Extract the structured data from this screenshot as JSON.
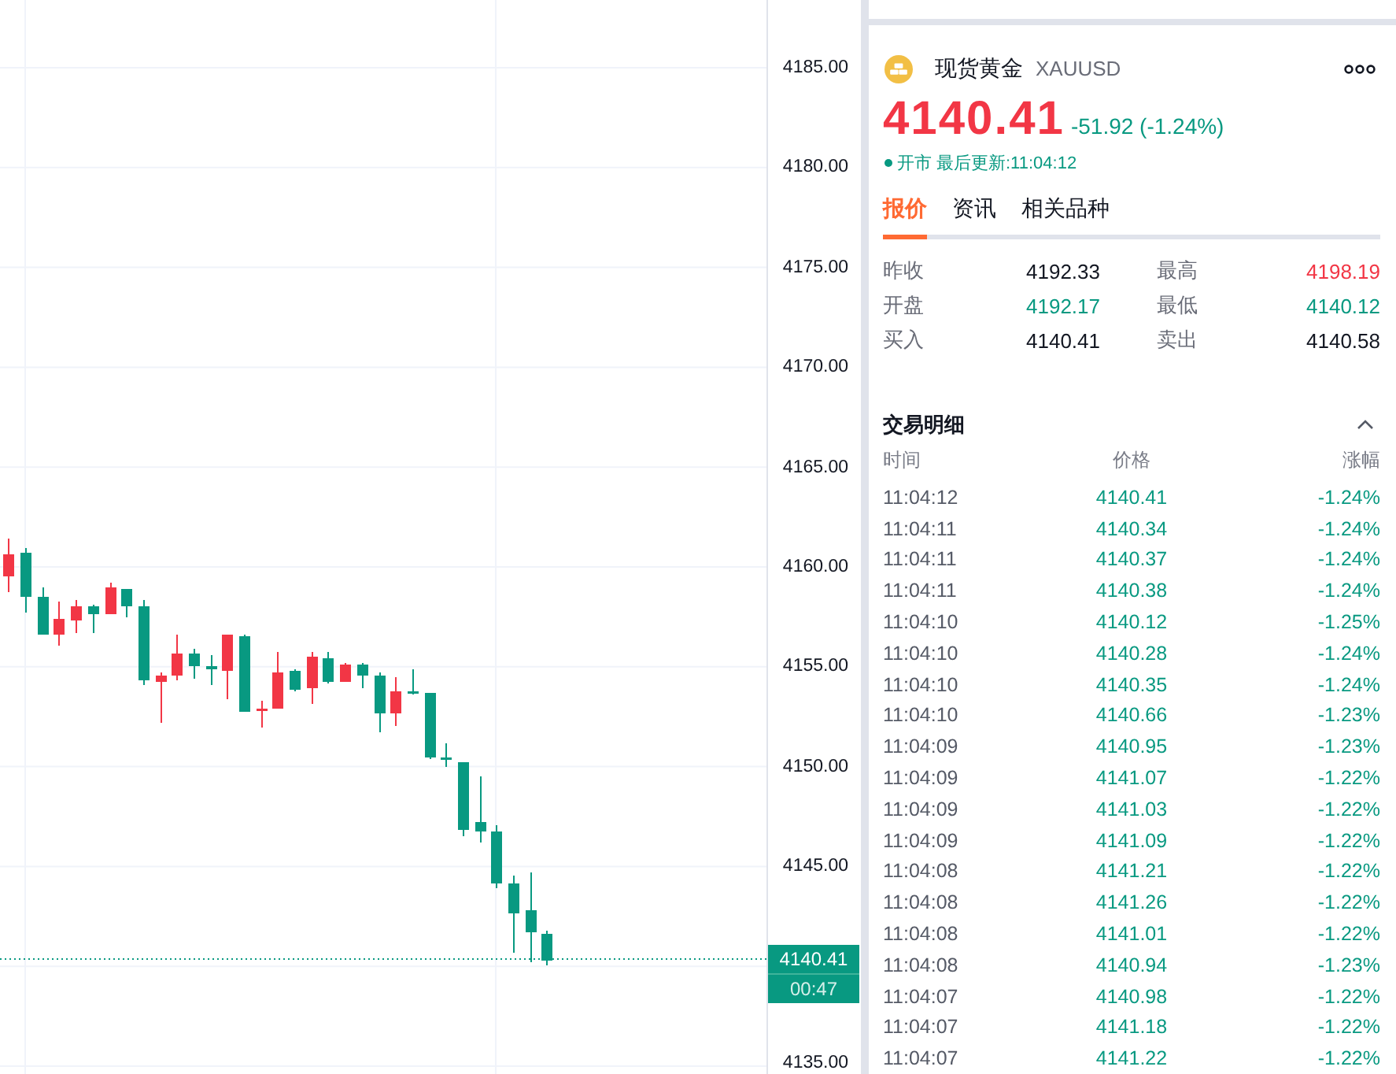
{
  "price_axis": {
    "labels": [
      "4185.00",
      "4180.00",
      "4175.00",
      "4170.00",
      "4165.00",
      "4160.00",
      "4155.00",
      "4150.00",
      "4145.00",
      "4135.00"
    ]
  },
  "last_price_tag": {
    "price": "4140.41",
    "countdown": "00:47"
  },
  "instrument": {
    "name": "现货黄金",
    "symbol": "XAUUSD"
  },
  "quote": {
    "price": "4140.41",
    "change": "-51.92 (-1.24%)",
    "status": "开市",
    "updated": "最后更新:11:04:12"
  },
  "tabs": [
    {
      "label": "报价",
      "selected": true
    },
    {
      "label": "资讯",
      "selected": false
    },
    {
      "label": "相关品种",
      "selected": false
    }
  ],
  "stats": [
    {
      "label": "昨收",
      "value": "4192.33",
      "color": "#131722"
    },
    {
      "label": "最高",
      "value": "4198.19",
      "color": "#f23645"
    },
    {
      "label": "开盘",
      "value": "4192.17",
      "color": "#089981"
    },
    {
      "label": "最低",
      "value": "4140.12",
      "color": "#089981"
    },
    {
      "label": "买入",
      "value": "4140.41",
      "color": "#131722"
    },
    {
      "label": "卖出",
      "value": "4140.58",
      "color": "#131722"
    }
  ],
  "trades": {
    "title": "交易明细",
    "expanded": true,
    "columns": [
      "时间",
      "价格",
      "涨幅"
    ],
    "rows": [
      {
        "time": "11:04:12",
        "price": "4140.41",
        "change": "-1.24%"
      },
      {
        "time": "11:04:11",
        "price": "4140.34",
        "change": "-1.24%"
      },
      {
        "time": "11:04:11",
        "price": "4140.37",
        "change": "-1.24%"
      },
      {
        "time": "11:04:11",
        "price": "4140.38",
        "change": "-1.24%"
      },
      {
        "time": "11:04:10",
        "price": "4140.12",
        "change": "-1.25%"
      },
      {
        "time": "11:04:10",
        "price": "4140.28",
        "change": "-1.24%"
      },
      {
        "time": "11:04:10",
        "price": "4140.35",
        "change": "-1.24%"
      },
      {
        "time": "11:04:10",
        "price": "4140.66",
        "change": "-1.23%"
      },
      {
        "time": "11:04:09",
        "price": "4140.95",
        "change": "-1.23%"
      },
      {
        "time": "11:04:09",
        "price": "4141.07",
        "change": "-1.22%"
      },
      {
        "time": "11:04:09",
        "price": "4141.03",
        "change": "-1.22%"
      },
      {
        "time": "11:04:09",
        "price": "4141.09",
        "change": "-1.22%"
      },
      {
        "time": "11:04:08",
        "price": "4141.21",
        "change": "-1.22%"
      },
      {
        "time": "11:04:08",
        "price": "4141.26",
        "change": "-1.22%"
      },
      {
        "time": "11:04:08",
        "price": "4141.01",
        "change": "-1.22%"
      },
      {
        "time": "11:04:08",
        "price": "4140.94",
        "change": "-1.23%"
      },
      {
        "time": "11:04:07",
        "price": "4140.98",
        "change": "-1.22%"
      },
      {
        "time": "11:04:07",
        "price": "4141.18",
        "change": "-1.22%"
      },
      {
        "time": "11:04:07",
        "price": "4141.22",
        "change": "-1.22%"
      }
    ]
  }
}
